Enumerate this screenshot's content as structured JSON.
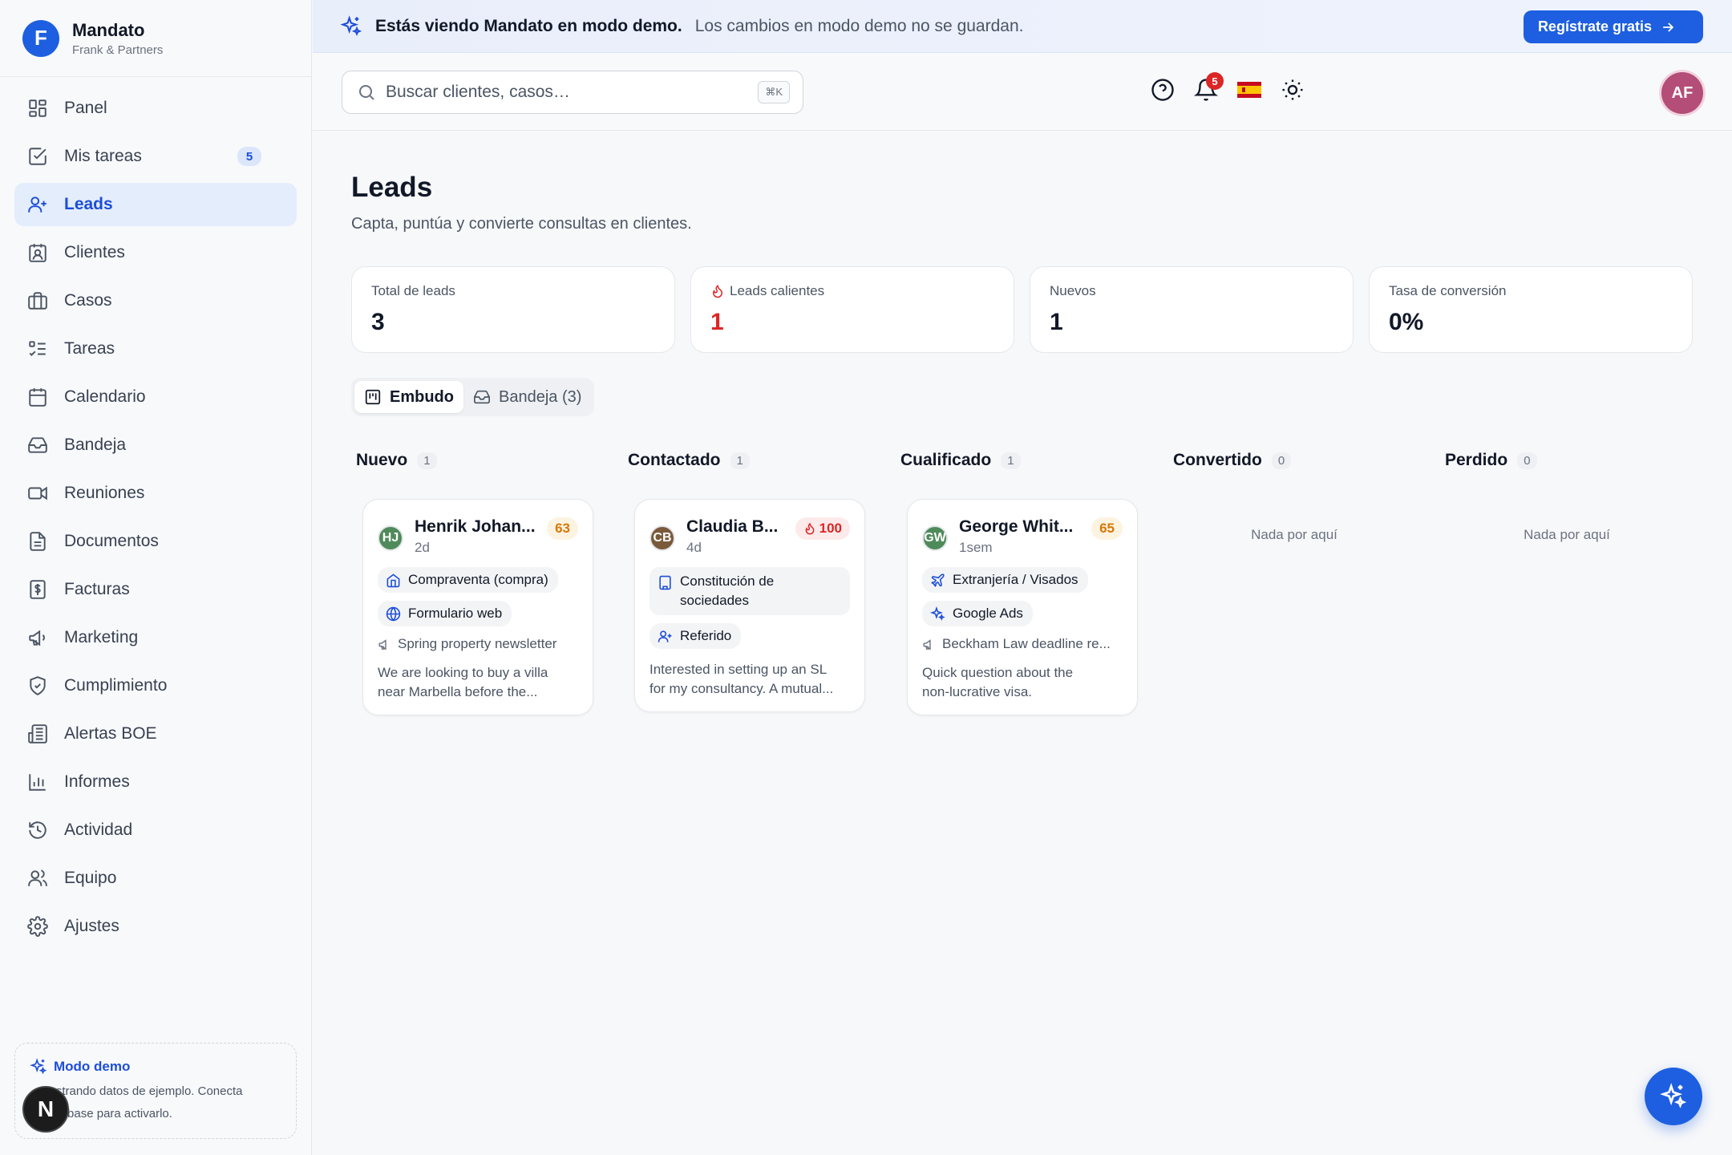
{
  "brand": {
    "initial": "F",
    "name": "Mandato",
    "org": "Frank & Partners"
  },
  "sidebar": {
    "items": [
      {
        "label": "Panel",
        "icon": "grid-icon"
      },
      {
        "label": "Mis tareas",
        "icon": "checkbox-icon",
        "badge": "5"
      },
      {
        "label": "Leads",
        "icon": "user-plus-icon",
        "active": true
      },
      {
        "label": "Clientes",
        "icon": "contact-icon"
      },
      {
        "label": "Casos",
        "icon": "briefcase-icon"
      },
      {
        "label": "Tareas",
        "icon": "list-check-icon"
      },
      {
        "label": "Calendario",
        "icon": "calendar-icon"
      },
      {
        "label": "Bandeja",
        "icon": "inbox-icon"
      },
      {
        "label": "Reuniones",
        "icon": "video-icon"
      },
      {
        "label": "Documentos",
        "icon": "document-icon"
      },
      {
        "label": "Facturas",
        "icon": "invoice-icon"
      },
      {
        "label": "Marketing",
        "icon": "megaphone-icon"
      },
      {
        "label": "Cumplimiento",
        "icon": "shield-icon"
      },
      {
        "label": "Alertas BOE",
        "icon": "newspaper-icon"
      },
      {
        "label": "Informes",
        "icon": "bar-chart-icon"
      },
      {
        "label": "Actividad",
        "icon": "history-icon"
      },
      {
        "label": "Equipo",
        "icon": "users-icon"
      },
      {
        "label": "Ajustes",
        "icon": "gear-icon"
      }
    ],
    "demo": {
      "title": "Modo demo",
      "line1": "Mostrando datos de ejemplo. Conecta",
      "line2": "Supabase para activarlo."
    },
    "n_badge": "N"
  },
  "banner": {
    "strong": "Estás viendo Mandato en modo demo.",
    "text": "Los cambios en modo demo no se guardan.",
    "cta": "Regístrate gratis"
  },
  "header": {
    "search_placeholder": "Buscar clientes, casos…",
    "search_shortcut": "⌘K",
    "notifications_count": "5",
    "language_flag": "es-flag-icon",
    "avatar": "AF"
  },
  "page": {
    "title": "Leads",
    "subtitle": "Capta, puntúa y convierte consultas en clientes."
  },
  "stats": [
    {
      "label": "Total de leads",
      "value": "3"
    },
    {
      "label": "Leads calientes",
      "value": "1",
      "hot": true
    },
    {
      "label": "Nuevos",
      "value": "1"
    },
    {
      "label": "Tasa de conversión",
      "value": "0%"
    }
  ],
  "tabs": [
    {
      "label": "Embudo",
      "active": true
    },
    {
      "label": "Bandeja (3)"
    }
  ],
  "columns": [
    {
      "title": "Nuevo",
      "count": "1"
    },
    {
      "title": "Contactado",
      "count": "1"
    },
    {
      "title": "Cualificado",
      "count": "1"
    },
    {
      "title": "Convertido",
      "count": "0",
      "empty": "Nada por aquí"
    },
    {
      "title": "Perdido",
      "count": "0",
      "empty": "Nada por aquí"
    }
  ],
  "cards": [
    {
      "initials": "HJ",
      "avatar_color": "#4f8a5b",
      "name": "Henrik Johan...",
      "ago": "2d",
      "score": "63",
      "score_style": "amber",
      "practice": "Compraventa (compra)",
      "source": "Formulario web",
      "campaign": "Spring property newsletter",
      "message_1": "We are looking to buy a villa",
      "message_2": "near Marbella before the..."
    },
    {
      "initials": "CB",
      "avatar_color": "#7a5a3a",
      "name": "Claudia B...",
      "ago": "4d",
      "score": "100",
      "score_style": "red",
      "practice": "Constitución de sociedades",
      "source": "Referido",
      "message_1": "Interested in setting up an SL",
      "message_2": "for my consultancy. A mutual..."
    },
    {
      "initials": "GW",
      "avatar_color": "#4f8a5b",
      "name": "George Whit...",
      "ago": "1sem",
      "score": "65",
      "score_style": "amber",
      "practice": "Extranjería / Visados",
      "source": "Google Ads",
      "campaign": "Beckham Law deadline re...",
      "message_1": "Quick question about the",
      "message_2": "non-lucrative visa."
    }
  ],
  "colors": {
    "accent": "#1d5fe0",
    "hot": "#dc2626",
    "warm": "#d97706",
    "active_bg": "#e4edfc"
  }
}
